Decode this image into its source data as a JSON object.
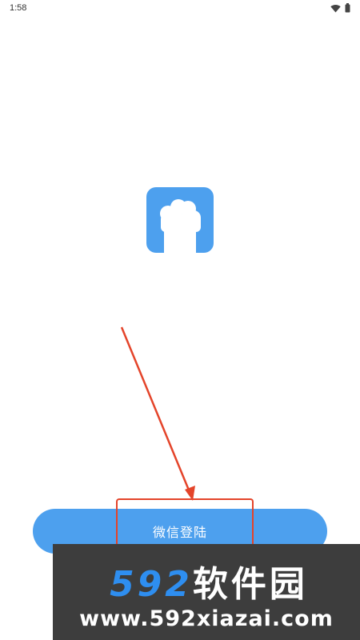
{
  "status_bar": {
    "time": "1:58"
  },
  "app_logo": {
    "icon": "paw-icon",
    "color": "#4da0ee"
  },
  "login": {
    "button_label": "微信登陆",
    "button_color": "#4da0ee"
  },
  "annotation": {
    "color": "#e4442a"
  },
  "watermark": {
    "brand_digits": "592",
    "brand_name": "软件园",
    "url": "www.592xiazai.com"
  }
}
